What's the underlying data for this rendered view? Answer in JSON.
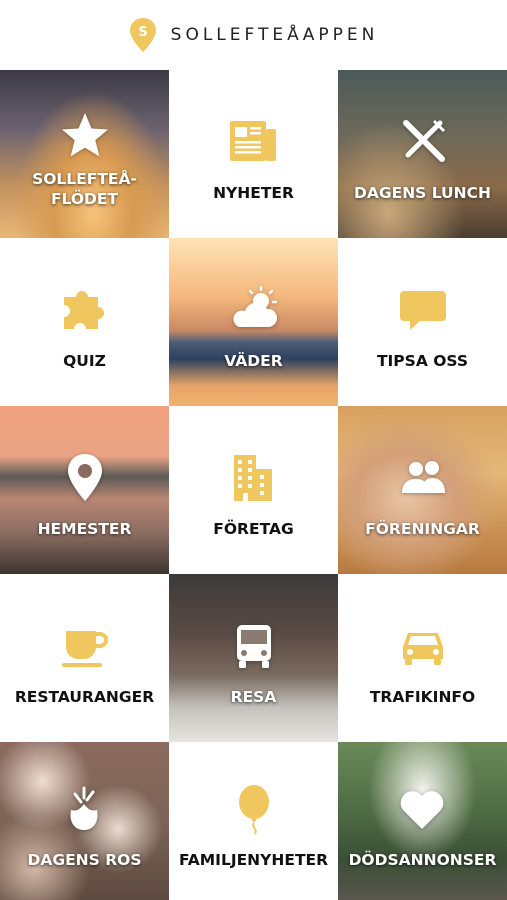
{
  "header": {
    "title": "SOLLEFTEÅAPPEN",
    "logo_icon": "location-pin-s-icon",
    "logo_letter": "S"
  },
  "colors": {
    "accent": "#F0C75E",
    "text_dark": "#111111",
    "text_light": "#FFFFFF"
  },
  "tiles": [
    {
      "id": "floden",
      "label_line1": "SOLLEFTEÅ-",
      "label_line2": "FLÖDET",
      "icon": "star-icon",
      "style": "photo"
    },
    {
      "id": "nyheter",
      "label": "NYHETER",
      "icon": "newspaper-icon",
      "style": "white"
    },
    {
      "id": "lunch",
      "label": "DAGENS LUNCH",
      "icon": "fork-knife-icon",
      "style": "photo"
    },
    {
      "id": "quiz",
      "label": "QUIZ",
      "icon": "puzzle-icon",
      "style": "white"
    },
    {
      "id": "vader",
      "label": "VÄDER",
      "icon": "partly-cloudy-icon",
      "style": "photo"
    },
    {
      "id": "tipsa",
      "label": "TIPSA OSS",
      "icon": "chat-bubble-icon",
      "style": "white"
    },
    {
      "id": "hemester",
      "label": "HEMESTER",
      "icon": "map-pin-icon",
      "style": "photo"
    },
    {
      "id": "foretag",
      "label": "FÖRETAG",
      "icon": "buildings-icon",
      "style": "white"
    },
    {
      "id": "foreningar",
      "label": "FÖRENINGAR",
      "icon": "people-icon",
      "style": "photo"
    },
    {
      "id": "restauranger",
      "label": "RESTAURANGER",
      "icon": "coffee-cup-icon",
      "style": "white"
    },
    {
      "id": "resa",
      "label": "RESA",
      "icon": "bus-icon",
      "style": "photo"
    },
    {
      "id": "trafikinfo",
      "label": "TRAFIKINFO",
      "icon": "car-icon",
      "style": "white"
    },
    {
      "id": "ros",
      "label": "DAGENS ROS",
      "icon": "rose-icon",
      "style": "photo"
    },
    {
      "id": "familj",
      "label": "FAMILJENYHETER",
      "icon": "balloon-icon",
      "style": "white"
    },
    {
      "id": "dods",
      "label": "DÖDSANNONSER",
      "icon": "heart-icon",
      "style": "photo"
    }
  ]
}
